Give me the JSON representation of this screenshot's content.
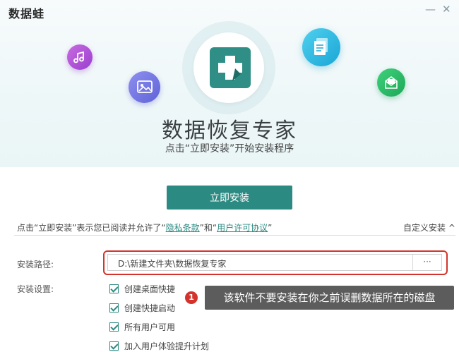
{
  "app": {
    "title": "数据蛙"
  },
  "window": {
    "minimize_glyph": "—",
    "close_glyph": "✕"
  },
  "hero": {
    "title": "数据恢复专家",
    "subtitle": "点击“立即安装”开始安装程序",
    "icons": [
      "music-icon",
      "image-icon",
      "document-icon",
      "mail-icon",
      "app-logo"
    ]
  },
  "install_button": {
    "label": "立即安装"
  },
  "agreement": {
    "prefix": "点击“立即安装”表示您已阅读并允许了“",
    "privacy_link": "隐私条款",
    "middle": "”和“",
    "license_link": "用户许可协议",
    "suffix": "”"
  },
  "custom_install": {
    "label": "自定义安装 ^"
  },
  "settings": {
    "path_label": "安装路径:",
    "path_value": "D:\\新建文件夹\\数据恢复专家",
    "browse_label": "···",
    "settings_label": "安装设置:",
    "options": [
      {
        "label": "创建桌面快捷",
        "checked": true
      },
      {
        "label": "创建快捷启动",
        "checked": true
      },
      {
        "label": "所有用户可用",
        "checked": true
      },
      {
        "label": "加入用户体验提升计划",
        "checked": true
      }
    ]
  },
  "annotation": {
    "badge": "1",
    "text": "该软件不要安装在你之前误删数据所在的磁盘",
    "highlight_color": "#d3332c"
  },
  "colors": {
    "accent": "#2b8a82",
    "highlight": "#d3332c"
  }
}
